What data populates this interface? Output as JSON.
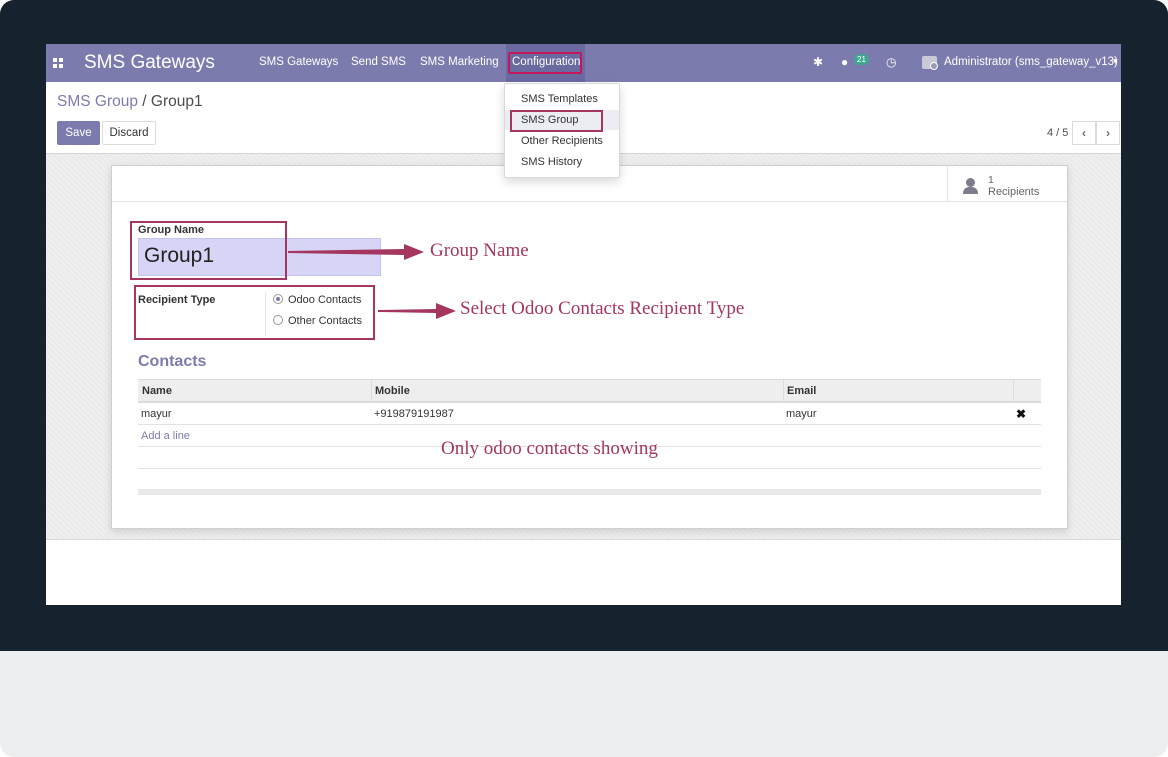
{
  "navbar": {
    "brand": "SMS Gateways",
    "menus": [
      "SMS Gateways",
      "Send SMS",
      "SMS Marketing",
      "Configuration"
    ],
    "message_count": "21",
    "user": "Administrator (sms_gateway_v13)"
  },
  "breadcrumb": {
    "parent": "SMS Group",
    "separator": " / ",
    "current": "Group1"
  },
  "buttons": {
    "save": "Save",
    "discard": "Discard"
  },
  "pager": {
    "text": "4 / 5",
    "prev": "‹",
    "next": "›"
  },
  "stat": {
    "value": "1",
    "label": "Recipients"
  },
  "form": {
    "group_name_label": "Group Name",
    "group_name_value": "Group1",
    "recipient_type_label": "Recipient Type",
    "recipient_options": [
      "Odoo Contacts",
      "Other Contacts"
    ],
    "selected_option": "Odoo Contacts"
  },
  "contacts": {
    "title": "Contacts",
    "columns": [
      "Name",
      "Mobile",
      "Email"
    ],
    "rows": [
      {
        "name": "mayur",
        "mobile": "+919879191987",
        "email": "mayur"
      }
    ],
    "add_line": "Add a line"
  },
  "dropdown": {
    "items": [
      "SMS Templates",
      "SMS Group",
      "Other Recipients",
      "SMS History"
    ],
    "active": "SMS Group"
  },
  "annotations": {
    "group_name": "Group Name",
    "recipient_type": "Select Odoo Contacts Recipient Type",
    "contacts_note": "Only odoo contacts showing"
  },
  "colors": {
    "primary": "#7c7bad",
    "annotation": "#a4365f",
    "frame": "#16222e"
  }
}
